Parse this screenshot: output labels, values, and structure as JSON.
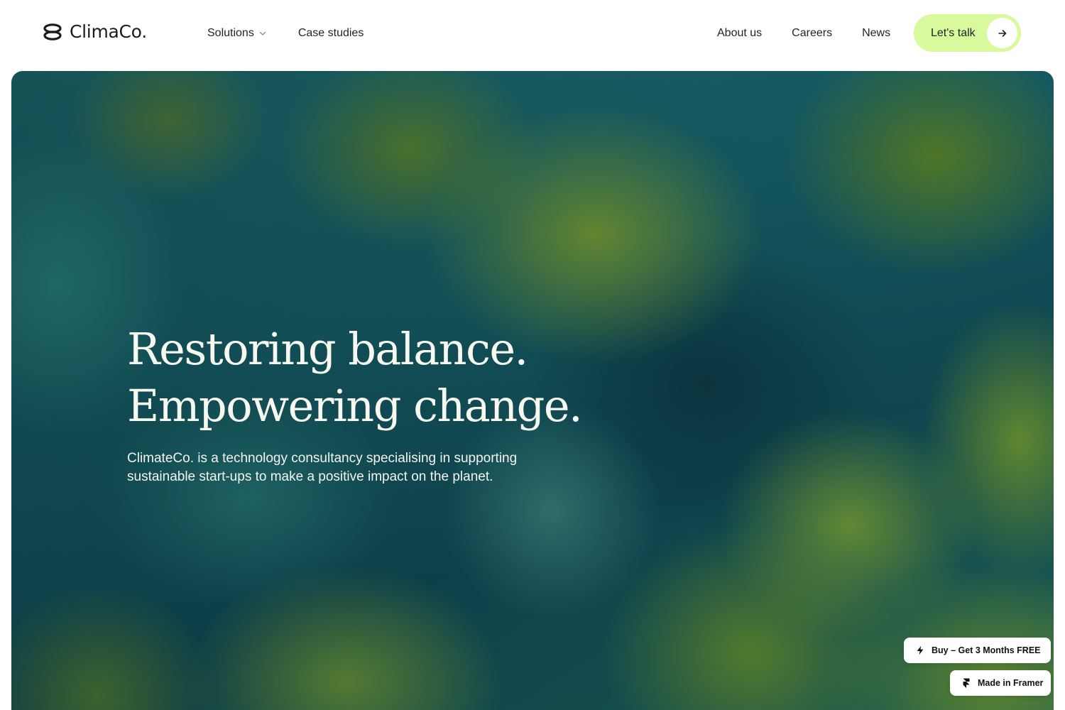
{
  "brand": {
    "name": "ClimaCo.",
    "icon": "logo-mark-icon"
  },
  "nav": {
    "left": [
      {
        "label": "Solutions",
        "has_dropdown": true
      },
      {
        "label": "Case studies",
        "has_dropdown": false
      }
    ],
    "right": [
      {
        "label": "About us"
      },
      {
        "label": "Careers"
      },
      {
        "label": "News"
      }
    ],
    "cta": {
      "label": "Let's talk",
      "icon": "arrow-right-icon"
    }
  },
  "hero": {
    "title_line_1": "Restoring balance.",
    "title_line_2": "Empowering change.",
    "subtitle_line_1": "ClimateCo. is a technology consultancy specialising in supporting",
    "subtitle_line_2": "sustainable start-ups to make a positive impact on the planet.",
    "background": "aerial forest and water image"
  },
  "badges": {
    "buy": {
      "label": "Buy – Get 3 Months FREE",
      "icon": "lightning-icon"
    },
    "framer": {
      "label": "Made in Framer",
      "icon": "framer-icon"
    }
  },
  "colors": {
    "cta_background": "#d9f99d",
    "text_dark": "#1f2322",
    "hero_text": "#f7f9ef"
  }
}
